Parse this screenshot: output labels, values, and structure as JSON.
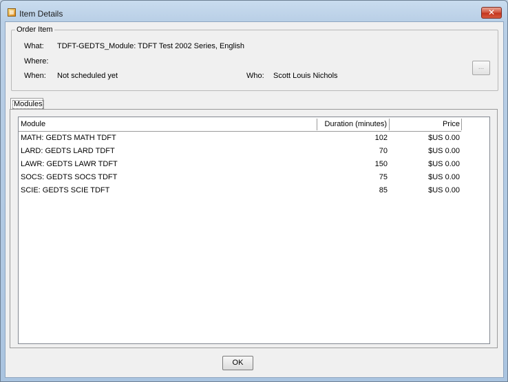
{
  "window": {
    "title": "Item Details",
    "close_label": "✕"
  },
  "order_item": {
    "legend": "Order Item",
    "what_label": "What:",
    "what_value": "TDFT-GEDTS_Module: TDFT Test 2002 Series, English",
    "where_label": "Where:",
    "where_value": "",
    "when_label": "When:",
    "when_value": "Not scheduled yet",
    "who_label": "Who:",
    "who_value": "Scott Louis Nichols",
    "browse_label": "..."
  },
  "tabs": [
    {
      "label": "Modules",
      "selected": true
    }
  ],
  "modules_table": {
    "columns": [
      "Module",
      "Duration (minutes)",
      "Price"
    ],
    "rows": [
      {
        "module": "MATH: GEDTS MATH TDFT",
        "duration": "102",
        "price": "$US 0.00"
      },
      {
        "module": "LARD: GEDTS LARD TDFT",
        "duration": "70",
        "price": "$US 0.00"
      },
      {
        "module": "LAWR: GEDTS LAWR TDFT",
        "duration": "150",
        "price": "$US 0.00"
      },
      {
        "module": "SOCS: GEDTS SOCS TDFT",
        "duration": "75",
        "price": "$US 0.00"
      },
      {
        "module": "SCIE: GEDTS SCIE TDFT",
        "duration": "85",
        "price": "$US 0.00"
      }
    ]
  },
  "footer": {
    "ok_label": "OK"
  },
  "colors": {
    "close_button": "#c4351e",
    "frame": "#b9cfe6",
    "client_bg": "#f0f0f0"
  }
}
